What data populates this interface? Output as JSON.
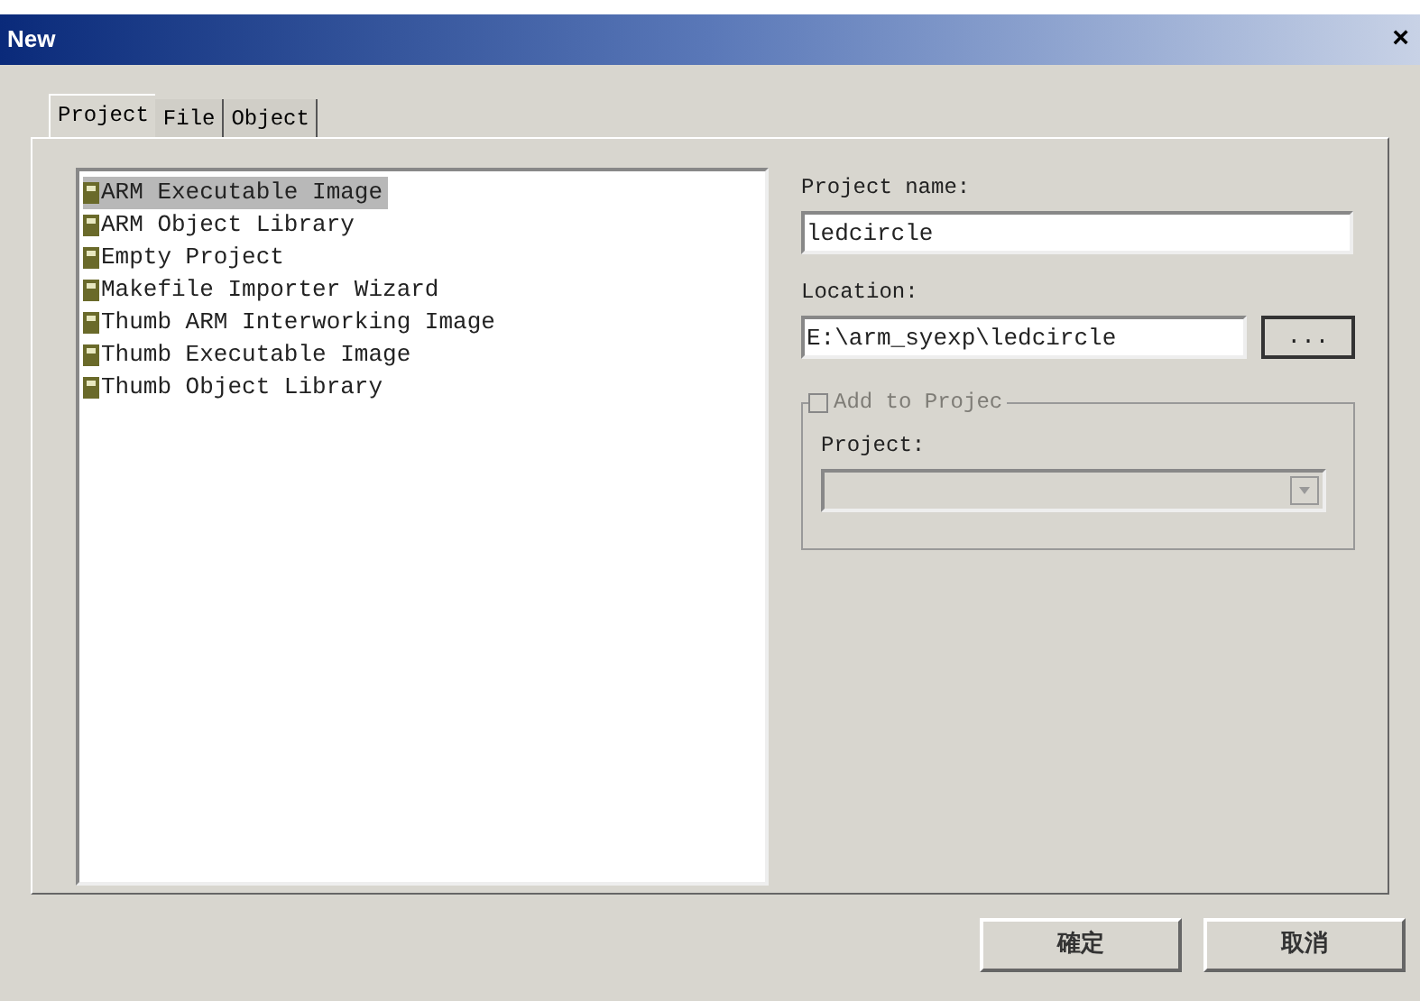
{
  "window": {
    "title": "New",
    "close": "×"
  },
  "tabs": [
    {
      "label": "Project",
      "selected": true
    },
    {
      "label": "File",
      "selected": false
    },
    {
      "label": "Object",
      "selected": false
    }
  ],
  "project_types": [
    {
      "label": "ARM Executable Image",
      "selected": true
    },
    {
      "label": "ARM Object Library",
      "selected": false
    },
    {
      "label": "Empty Project",
      "selected": false
    },
    {
      "label": "Makefile Importer Wizard",
      "selected": false
    },
    {
      "label": "Thumb ARM Interworking Image",
      "selected": false
    },
    {
      "label": "Thumb Executable Image",
      "selected": false
    },
    {
      "label": "Thumb Object Library",
      "selected": false
    }
  ],
  "project_name": {
    "label": "Project name:",
    "value": "ledcircle"
  },
  "location": {
    "label": "Location:",
    "value": "E:\\arm_syexp\\ledcircle",
    "browse": "..."
  },
  "add_to_project": {
    "label": "Add to Projec",
    "checked": false,
    "disabled": true
  },
  "project": {
    "label": "Project:",
    "disabled": true
  },
  "buttons": [
    "確定",
    "取消"
  ]
}
